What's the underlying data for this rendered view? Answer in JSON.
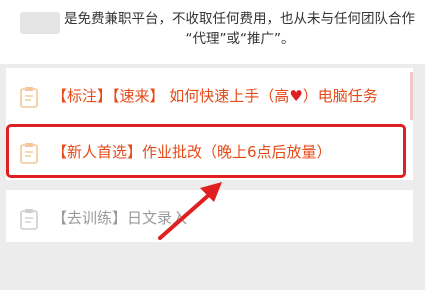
{
  "notice": {
    "line1": "是免费兼职平台，不收取任何费用，也从未与任何团队合作",
    "line2": "“代理”或“推广”。"
  },
  "tasks": [
    {
      "tags": "【标注】【速来】",
      "title_before": "如何快速上手（高",
      "heart": "♥",
      "title_after": "）电脑任务"
    },
    {
      "tags": "【新人首选】",
      "title": "作业批改（晚上6点后放量）"
    },
    {
      "tags": "【去训练】",
      "title": "日文录入"
    }
  ],
  "colors": {
    "highlight": "#e02020",
    "task_text": "#e64a19",
    "disabled_text": "#9a9a9a"
  }
}
